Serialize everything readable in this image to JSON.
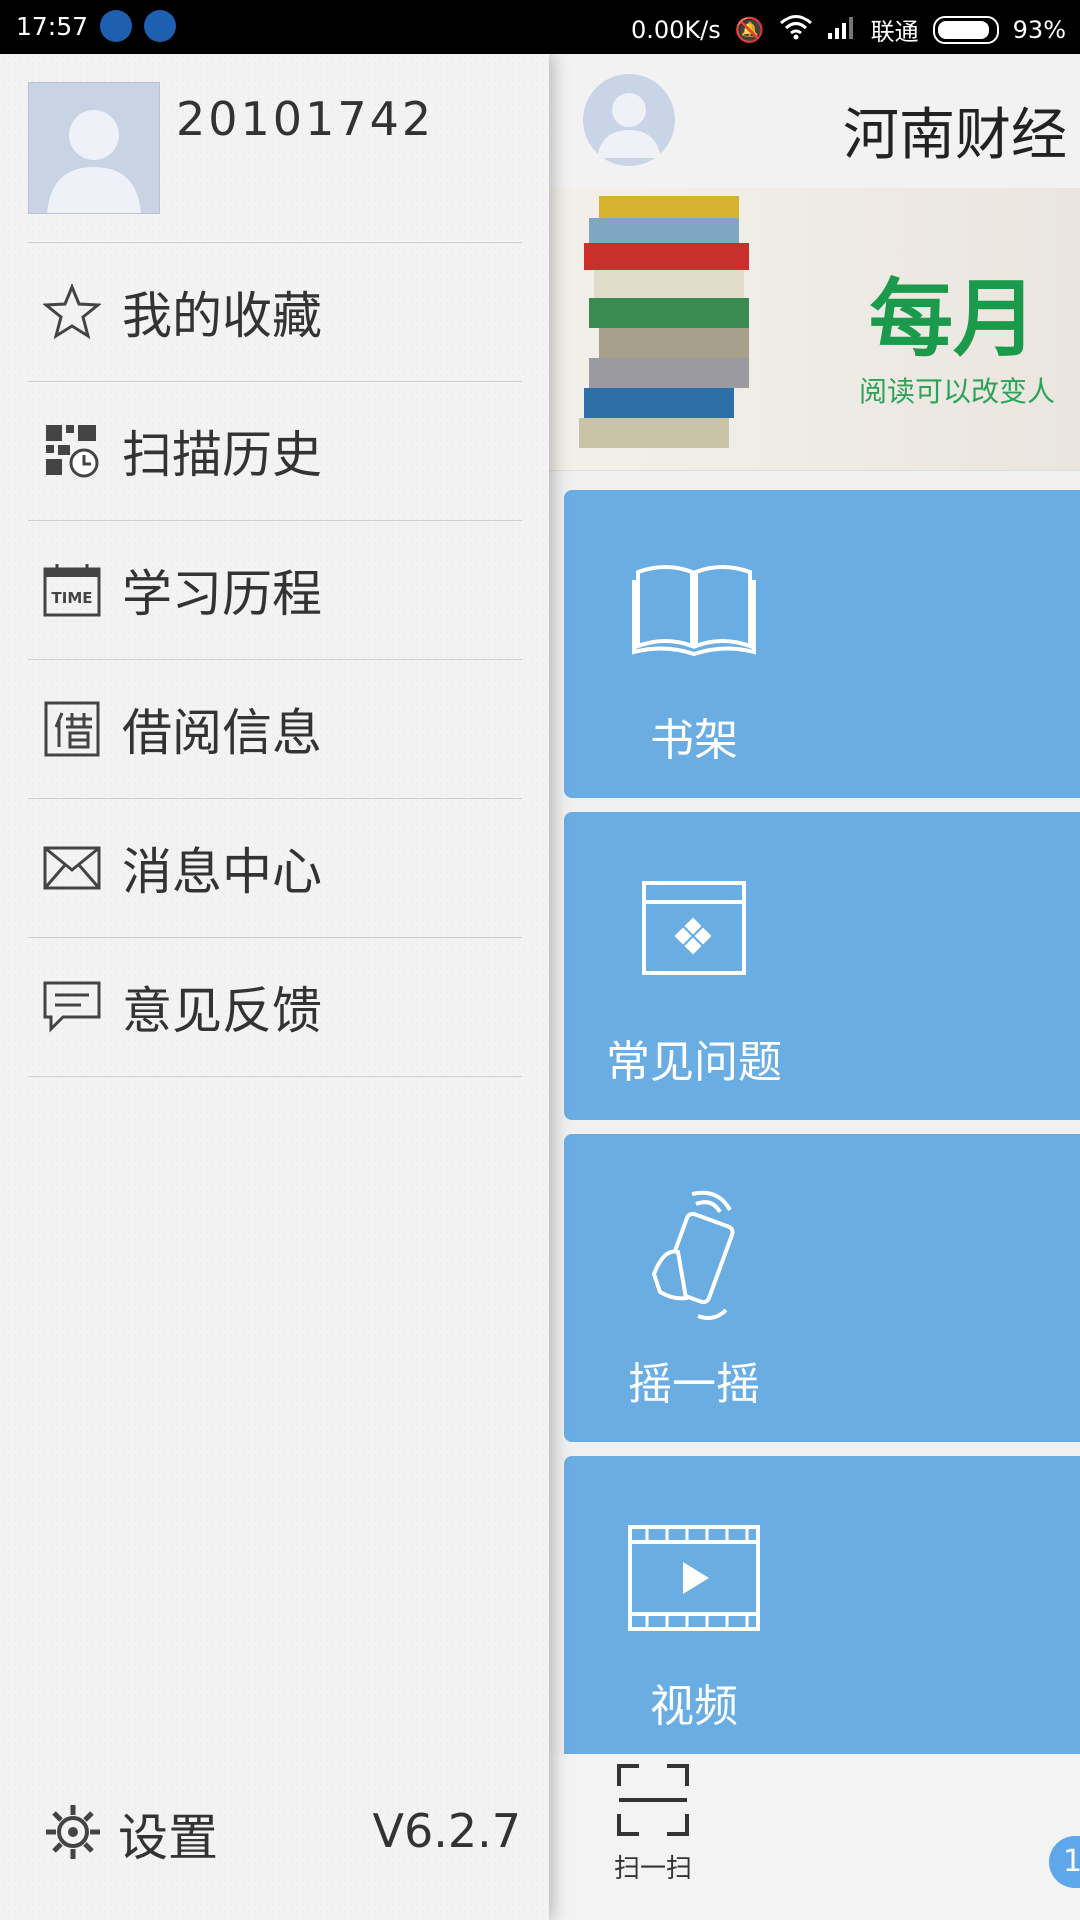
{
  "status_bar": {
    "time": "17:57",
    "speed": "0.00K/s",
    "carrier": "联通",
    "battery": "93%"
  },
  "drawer": {
    "username": "20101742",
    "menu": [
      {
        "label": "我的收藏",
        "icon": "star-icon"
      },
      {
        "label": "扫描历史",
        "icon": "qr-history-icon"
      },
      {
        "label": "学习历程",
        "icon": "time-calendar-icon"
      },
      {
        "label": "借阅信息",
        "icon": "borrow-icon"
      },
      {
        "label": "消息中心",
        "icon": "envelope-icon"
      },
      {
        "label": "意见反馈",
        "icon": "feedback-icon"
      }
    ],
    "settings_label": "设置",
    "version": "V6.2.7"
  },
  "main": {
    "title": "河南财经",
    "banner_text_big": "每月",
    "banner_text_small": "阅读可以改变人",
    "tiles": [
      {
        "label": "书架",
        "icon": "book-icon"
      },
      {
        "label": "常见问题",
        "icon": "faq-window-icon"
      },
      {
        "label": "摇一摇",
        "icon": "shake-phone-icon"
      },
      {
        "label": "视频",
        "icon": "video-icon"
      }
    ],
    "scan_label": "扫一扫",
    "badge": "1"
  },
  "colors": {
    "tile_blue": "#6aade3",
    "banner_green": "#1a9a4a"
  }
}
